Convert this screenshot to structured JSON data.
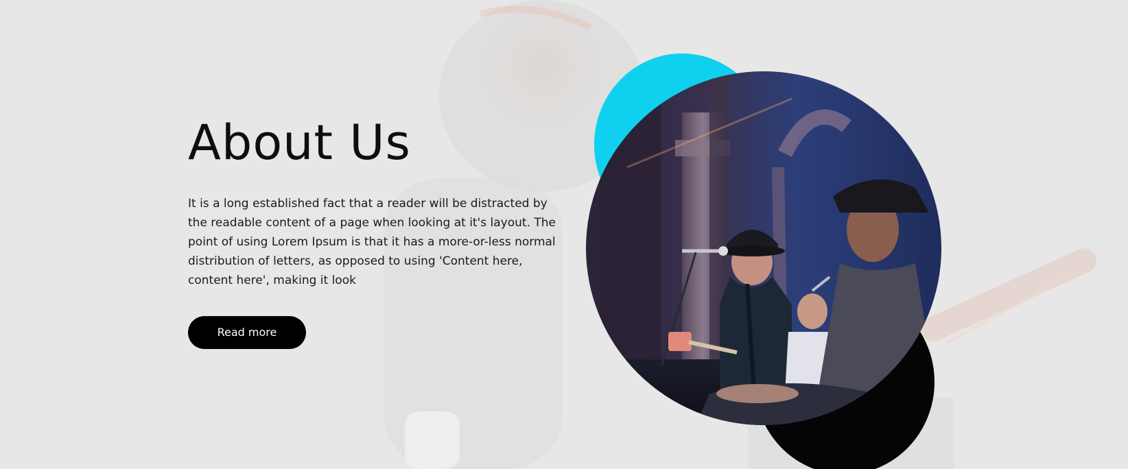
{
  "section": {
    "title": "About Us",
    "description": "It is a long established fact that a reader will be distracted by the readable content of a page when looking at it's layout. The point of using Lorem Ipsum is that it has a more-or-less normal distribution of letters, as opposed to using 'Content here, content here', making it look",
    "read_more_label": "Read more"
  },
  "colors": {
    "background": "#e6e7e6",
    "accent_cyan": "#0fd1ef",
    "button": "#000000",
    "title": "#0b0f10"
  },
  "visual": {
    "image": "circular photo of band performing on stage (singer with hat at microphone, guitarist)",
    "decor": [
      "cyan-circle",
      "black-circle"
    ]
  }
}
